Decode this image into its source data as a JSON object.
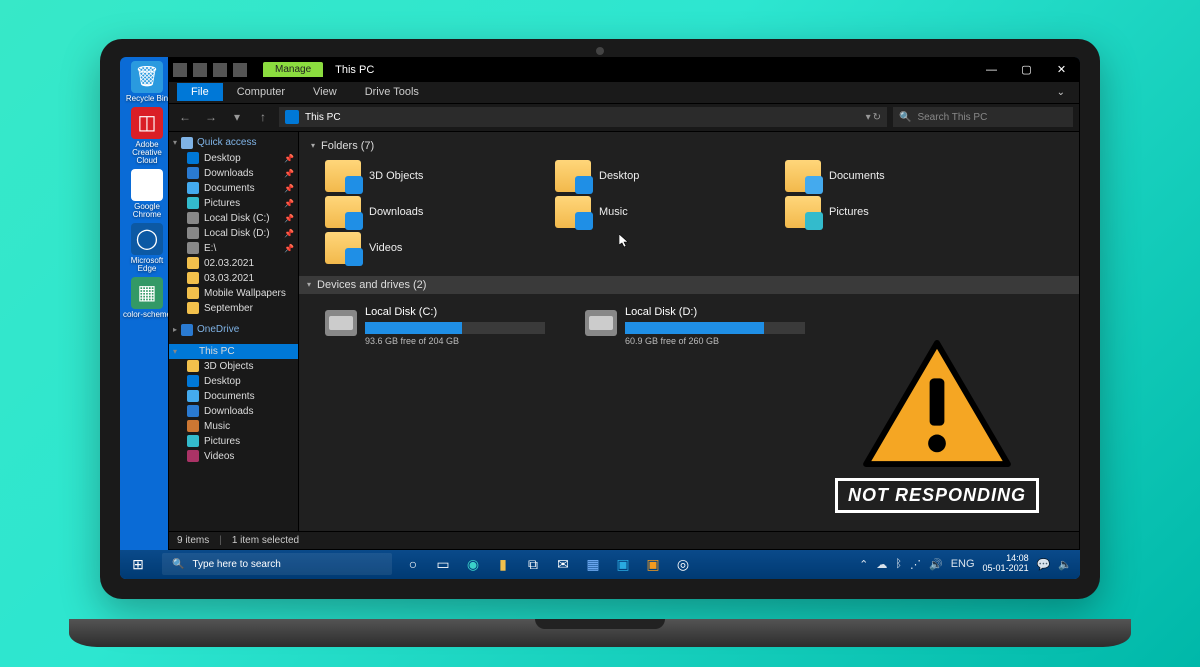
{
  "desktop": {
    "icons": [
      {
        "label": "Recycle Bin",
        "color": "#2a9adf",
        "glyph": "🗑"
      },
      {
        "label": "Adobe Creative Cloud",
        "color": "#da1f26",
        "glyph": "◫"
      },
      {
        "label": "Google Chrome",
        "color": "#fff",
        "glyph": "◎"
      },
      {
        "label": "Microsoft Edge",
        "color": "#0c59a4",
        "glyph": "◯"
      },
      {
        "label": "color-scheme",
        "color": "#339966",
        "glyph": "▦"
      }
    ]
  },
  "window": {
    "manage_label": "Manage",
    "title": "This PC",
    "ribbon": {
      "file": "File",
      "computer": "Computer",
      "view": "View",
      "drive_tools": "Drive Tools"
    },
    "address": {
      "path": "This PC",
      "refresh": "↻"
    },
    "search": {
      "placeholder": "Search This PC"
    },
    "controls": {
      "min": "—",
      "max": "▢",
      "close": "✕"
    }
  },
  "sidebar": {
    "quick_access": "Quick access",
    "qa_items": [
      {
        "label": "Desktop",
        "icon": "dt",
        "pin": true
      },
      {
        "label": "Downloads",
        "icon": "dl",
        "pin": true
      },
      {
        "label": "Documents",
        "icon": "doc",
        "pin": true
      },
      {
        "label": "Pictures",
        "icon": "pic",
        "pin": true
      },
      {
        "label": "Local Disk (C:)",
        "icon": "disk",
        "pin": true
      },
      {
        "label": "Local Disk (D:)",
        "icon": "disk",
        "pin": true
      },
      {
        "label": "E:\\",
        "icon": "disk",
        "pin": true
      },
      {
        "label": "02.03.2021",
        "icon": "folder",
        "pin": false
      },
      {
        "label": "03.03.2021",
        "icon": "folder",
        "pin": false
      },
      {
        "label": "Mobile Wallpapers",
        "icon": "folder",
        "pin": false
      },
      {
        "label": "September",
        "icon": "folder",
        "pin": false
      }
    ],
    "onedrive": "OneDrive",
    "this_pc": "This PC",
    "pc_items": [
      {
        "label": "3D Objects",
        "icon": "folder"
      },
      {
        "label": "Desktop",
        "icon": "dt"
      },
      {
        "label": "Documents",
        "icon": "doc"
      },
      {
        "label": "Downloads",
        "icon": "dl"
      },
      {
        "label": "Music",
        "icon": "music"
      },
      {
        "label": "Pictures",
        "icon": "pic"
      },
      {
        "label": "Videos",
        "icon": "video"
      }
    ]
  },
  "content": {
    "folders_header": "Folders (7)",
    "folders": [
      {
        "label": "3D Objects",
        "overlay": "#1f8fe6"
      },
      {
        "label": "Desktop",
        "overlay": "#1f8fe6"
      },
      {
        "label": "Documents",
        "overlay": "#44aaee"
      },
      {
        "label": "Downloads",
        "overlay": "#1f8fe6"
      },
      {
        "label": "Music",
        "overlay": "#1f8fe6"
      },
      {
        "label": "Pictures",
        "overlay": "#33bbcc"
      },
      {
        "label": "Videos",
        "overlay": "#1f8fe6"
      }
    ],
    "devices_header": "Devices and drives (2)",
    "drives": [
      {
        "name": "Local Disk (C:)",
        "free": "93.6 GB free of 204 GB",
        "used_pct": 54
      },
      {
        "name": "Local Disk (D:)",
        "free": "60.9 GB free of 260 GB",
        "used_pct": 77
      }
    ]
  },
  "statusbar": {
    "items": "9 items",
    "selected": "1 item selected"
  },
  "warning": {
    "text": "NOT RESPONDING"
  },
  "taskbar": {
    "search_placeholder": "Type here to search",
    "tray": {
      "lang": "ENG",
      "time": "14:08",
      "date": "05-01-2021"
    }
  }
}
